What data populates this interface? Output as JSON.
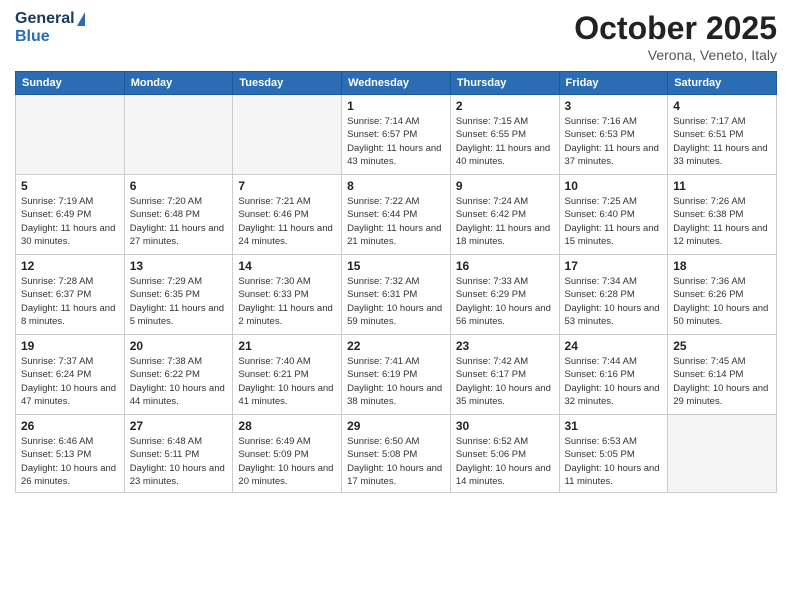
{
  "header": {
    "logo_general": "General",
    "logo_blue": "Blue",
    "month_title": "October 2025",
    "location": "Verona, Veneto, Italy"
  },
  "calendar": {
    "days_of_week": [
      "Sunday",
      "Monday",
      "Tuesday",
      "Wednesday",
      "Thursday",
      "Friday",
      "Saturday"
    ],
    "weeks": [
      [
        {
          "day": "",
          "detail": ""
        },
        {
          "day": "",
          "detail": ""
        },
        {
          "day": "",
          "detail": ""
        },
        {
          "day": "1",
          "detail": "Sunrise: 7:14 AM\nSunset: 6:57 PM\nDaylight: 11 hours\nand 43 minutes."
        },
        {
          "day": "2",
          "detail": "Sunrise: 7:15 AM\nSunset: 6:55 PM\nDaylight: 11 hours\nand 40 minutes."
        },
        {
          "day": "3",
          "detail": "Sunrise: 7:16 AM\nSunset: 6:53 PM\nDaylight: 11 hours\nand 37 minutes."
        },
        {
          "day": "4",
          "detail": "Sunrise: 7:17 AM\nSunset: 6:51 PM\nDaylight: 11 hours\nand 33 minutes."
        }
      ],
      [
        {
          "day": "5",
          "detail": "Sunrise: 7:19 AM\nSunset: 6:49 PM\nDaylight: 11 hours\nand 30 minutes."
        },
        {
          "day": "6",
          "detail": "Sunrise: 7:20 AM\nSunset: 6:48 PM\nDaylight: 11 hours\nand 27 minutes."
        },
        {
          "day": "7",
          "detail": "Sunrise: 7:21 AM\nSunset: 6:46 PM\nDaylight: 11 hours\nand 24 minutes."
        },
        {
          "day": "8",
          "detail": "Sunrise: 7:22 AM\nSunset: 6:44 PM\nDaylight: 11 hours\nand 21 minutes."
        },
        {
          "day": "9",
          "detail": "Sunrise: 7:24 AM\nSunset: 6:42 PM\nDaylight: 11 hours\nand 18 minutes."
        },
        {
          "day": "10",
          "detail": "Sunrise: 7:25 AM\nSunset: 6:40 PM\nDaylight: 11 hours\nand 15 minutes."
        },
        {
          "day": "11",
          "detail": "Sunrise: 7:26 AM\nSunset: 6:38 PM\nDaylight: 11 hours\nand 12 minutes."
        }
      ],
      [
        {
          "day": "12",
          "detail": "Sunrise: 7:28 AM\nSunset: 6:37 PM\nDaylight: 11 hours\nand 8 minutes."
        },
        {
          "day": "13",
          "detail": "Sunrise: 7:29 AM\nSunset: 6:35 PM\nDaylight: 11 hours\nand 5 minutes."
        },
        {
          "day": "14",
          "detail": "Sunrise: 7:30 AM\nSunset: 6:33 PM\nDaylight: 11 hours\nand 2 minutes."
        },
        {
          "day": "15",
          "detail": "Sunrise: 7:32 AM\nSunset: 6:31 PM\nDaylight: 10 hours\nand 59 minutes."
        },
        {
          "day": "16",
          "detail": "Sunrise: 7:33 AM\nSunset: 6:29 PM\nDaylight: 10 hours\nand 56 minutes."
        },
        {
          "day": "17",
          "detail": "Sunrise: 7:34 AM\nSunset: 6:28 PM\nDaylight: 10 hours\nand 53 minutes."
        },
        {
          "day": "18",
          "detail": "Sunrise: 7:36 AM\nSunset: 6:26 PM\nDaylight: 10 hours\nand 50 minutes."
        }
      ],
      [
        {
          "day": "19",
          "detail": "Sunrise: 7:37 AM\nSunset: 6:24 PM\nDaylight: 10 hours\nand 47 minutes."
        },
        {
          "day": "20",
          "detail": "Sunrise: 7:38 AM\nSunset: 6:22 PM\nDaylight: 10 hours\nand 44 minutes."
        },
        {
          "day": "21",
          "detail": "Sunrise: 7:40 AM\nSunset: 6:21 PM\nDaylight: 10 hours\nand 41 minutes."
        },
        {
          "day": "22",
          "detail": "Sunrise: 7:41 AM\nSunset: 6:19 PM\nDaylight: 10 hours\nand 38 minutes."
        },
        {
          "day": "23",
          "detail": "Sunrise: 7:42 AM\nSunset: 6:17 PM\nDaylight: 10 hours\nand 35 minutes."
        },
        {
          "day": "24",
          "detail": "Sunrise: 7:44 AM\nSunset: 6:16 PM\nDaylight: 10 hours\nand 32 minutes."
        },
        {
          "day": "25",
          "detail": "Sunrise: 7:45 AM\nSunset: 6:14 PM\nDaylight: 10 hours\nand 29 minutes."
        }
      ],
      [
        {
          "day": "26",
          "detail": "Sunrise: 6:46 AM\nSunset: 5:13 PM\nDaylight: 10 hours\nand 26 minutes."
        },
        {
          "day": "27",
          "detail": "Sunrise: 6:48 AM\nSunset: 5:11 PM\nDaylight: 10 hours\nand 23 minutes."
        },
        {
          "day": "28",
          "detail": "Sunrise: 6:49 AM\nSunset: 5:09 PM\nDaylight: 10 hours\nand 20 minutes."
        },
        {
          "day": "29",
          "detail": "Sunrise: 6:50 AM\nSunset: 5:08 PM\nDaylight: 10 hours\nand 17 minutes."
        },
        {
          "day": "30",
          "detail": "Sunrise: 6:52 AM\nSunset: 5:06 PM\nDaylight: 10 hours\nand 14 minutes."
        },
        {
          "day": "31",
          "detail": "Sunrise: 6:53 AM\nSunset: 5:05 PM\nDaylight: 10 hours\nand 11 minutes."
        },
        {
          "day": "",
          "detail": ""
        }
      ]
    ]
  }
}
